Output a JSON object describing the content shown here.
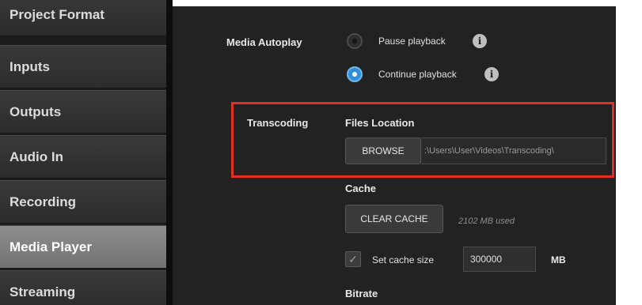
{
  "sidebar": {
    "items": [
      {
        "label": "Project Format"
      },
      {
        "label": "Inputs"
      },
      {
        "label": "Outputs"
      },
      {
        "label": "Audio In"
      },
      {
        "label": "Recording"
      },
      {
        "label": "Media Player"
      },
      {
        "label": "Streaming"
      }
    ],
    "active": "Media Player"
  },
  "media_autoplay": {
    "label": "Media Autoplay",
    "options": [
      {
        "label": "Pause playback",
        "selected": false
      },
      {
        "label": "Continue playback",
        "selected": true
      }
    ],
    "info_glyph": "i"
  },
  "transcoding": {
    "label": "Transcoding",
    "files_location_label": "Files Location",
    "browse_label": "BROWSE",
    "path_value": ":\\Users\\User\\Videos\\Transcoding\\"
  },
  "cache": {
    "label": "Cache",
    "clear_label": "CLEAR CACHE",
    "used_text": "2102 MB used",
    "set_size_label": "Set cache size",
    "set_size_checked": true,
    "size_value": "300000",
    "unit": "MB"
  },
  "bitrate": {
    "label": "Bitrate"
  },
  "colors": {
    "accent_blue": "#2f8fd8",
    "highlight_red": "#e0301e",
    "panel_bg": "#222222"
  }
}
